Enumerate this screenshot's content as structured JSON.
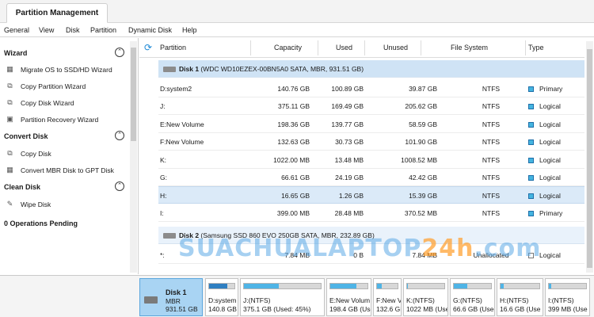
{
  "tab": {
    "label": "Partition Management"
  },
  "menu": [
    "General",
    "View",
    "Disk",
    "Partition",
    "Dynamic Disk",
    "Help"
  ],
  "sidebar": {
    "sections": [
      {
        "title": "Wizard",
        "items": [
          {
            "label": "Migrate OS to SSD/HD Wizard",
            "icon": "migrate-icon"
          },
          {
            "label": "Copy Partition Wizard",
            "icon": "copy-partition-icon"
          },
          {
            "label": "Copy Disk Wizard",
            "icon": "copy-disk-icon"
          },
          {
            "label": "Partition Recovery Wizard",
            "icon": "recovery-icon"
          }
        ]
      },
      {
        "title": "Convert Disk",
        "items": [
          {
            "label": "Copy Disk",
            "icon": "copy-disk-icon"
          },
          {
            "label": "Convert MBR Disk to GPT Disk",
            "icon": "convert-icon"
          }
        ]
      },
      {
        "title": "Clean Disk",
        "items": [
          {
            "label": "Wipe Disk",
            "icon": "eraser-icon"
          }
        ]
      }
    ],
    "pending": "0 Operations Pending"
  },
  "table": {
    "headers": {
      "partition": "Partition",
      "capacity": "Capacity",
      "used": "Used",
      "unused": "Unused",
      "filesystem": "File System",
      "type": "Type"
    },
    "disk1": {
      "name": "Disk 1",
      "detail": "(WDC WD10EZEX-00BN5A0 SATA, MBR, 931.51 GB)"
    },
    "disk1_rows": [
      {
        "partition": "D:system2",
        "capacity": "140.76 GB",
        "used": "100.89 GB",
        "unused": "39.87 GB",
        "fs": "NTFS",
        "type": "Primary"
      },
      {
        "partition": "J:",
        "capacity": "375.11 GB",
        "used": "169.49 GB",
        "unused": "205.62 GB",
        "fs": "NTFS",
        "type": "Logical"
      },
      {
        "partition": "E:New Volume",
        "capacity": "198.36 GB",
        "used": "139.77 GB",
        "unused": "58.59 GB",
        "fs": "NTFS",
        "type": "Logical"
      },
      {
        "partition": "F:New Volume",
        "capacity": "132.63 GB",
        "used": "30.73 GB",
        "unused": "101.90 GB",
        "fs": "NTFS",
        "type": "Logical"
      },
      {
        "partition": "K:",
        "capacity": "1022.00 MB",
        "used": "13.48 MB",
        "unused": "1008.52 MB",
        "fs": "NTFS",
        "type": "Logical"
      },
      {
        "partition": "G:",
        "capacity": "66.61 GB",
        "used": "24.19 GB",
        "unused": "42.42 GB",
        "fs": "NTFS",
        "type": "Logical"
      },
      {
        "partition": "H:",
        "capacity": "16.65 GB",
        "used": "1.26 GB",
        "unused": "15.39 GB",
        "fs": "NTFS",
        "type": "Logical"
      },
      {
        "partition": "I:",
        "capacity": "399.00 MB",
        "used": "28.48 MB",
        "unused": "370.52 MB",
        "fs": "NTFS",
        "type": "Primary"
      }
    ],
    "disk2": {
      "name": "Disk 2",
      "detail": "(Samsung SSD 860 EVO 250GB SATA, MBR, 232.89 GB)"
    },
    "disk2_rows": [
      {
        "partition": "*:",
        "capacity": "7.84 MB",
        "used": "0 B",
        "unused": "7.84 MB",
        "fs": "Unallocated",
        "type": "Logical"
      }
    ]
  },
  "diskmap": {
    "disk": {
      "name": "Disk 1",
      "type": "MBR",
      "size": "931.51 GB"
    },
    "partitions": [
      {
        "name": "D:system",
        "detail": "140.8 GB",
        "used_fraction": 0.72
      },
      {
        "name": "J:(NTFS)",
        "detail": "375.1 GB (Used: 45%)",
        "used_fraction": 0.45
      },
      {
        "name": "E:New Volum",
        "detail": "198.4 GB (Use",
        "used_fraction": 0.7
      },
      {
        "name": "F:New V",
        "detail": "132.6 GB",
        "used_fraction": 0.23
      },
      {
        "name": "K:(NTFS)",
        "detail": "1022 MB (Use",
        "used_fraction": 0.01
      },
      {
        "name": "G:(NTFS)",
        "detail": "66.6 GB (Usec",
        "used_fraction": 0.36
      },
      {
        "name": "H:(NTFS)",
        "detail": "16.6 GB (Use",
        "used_fraction": 0.08
      },
      {
        "name": "I:(NTFS)",
        "detail": "399 MB (Use",
        "used_fraction": 0.07
      }
    ]
  },
  "watermark": {
    "main": "SUACHUALAPTOP",
    "accent": "24h",
    "suffix": ".com"
  },
  "colors": {
    "accent": "#1f8ad6",
    "selected_row": "#dbeaf8",
    "disk_row": "#cfe3f5",
    "bar_fill": "#4fb4e6",
    "watermark_blue": "#5caae6",
    "watermark_orange": "#ff9c28"
  }
}
